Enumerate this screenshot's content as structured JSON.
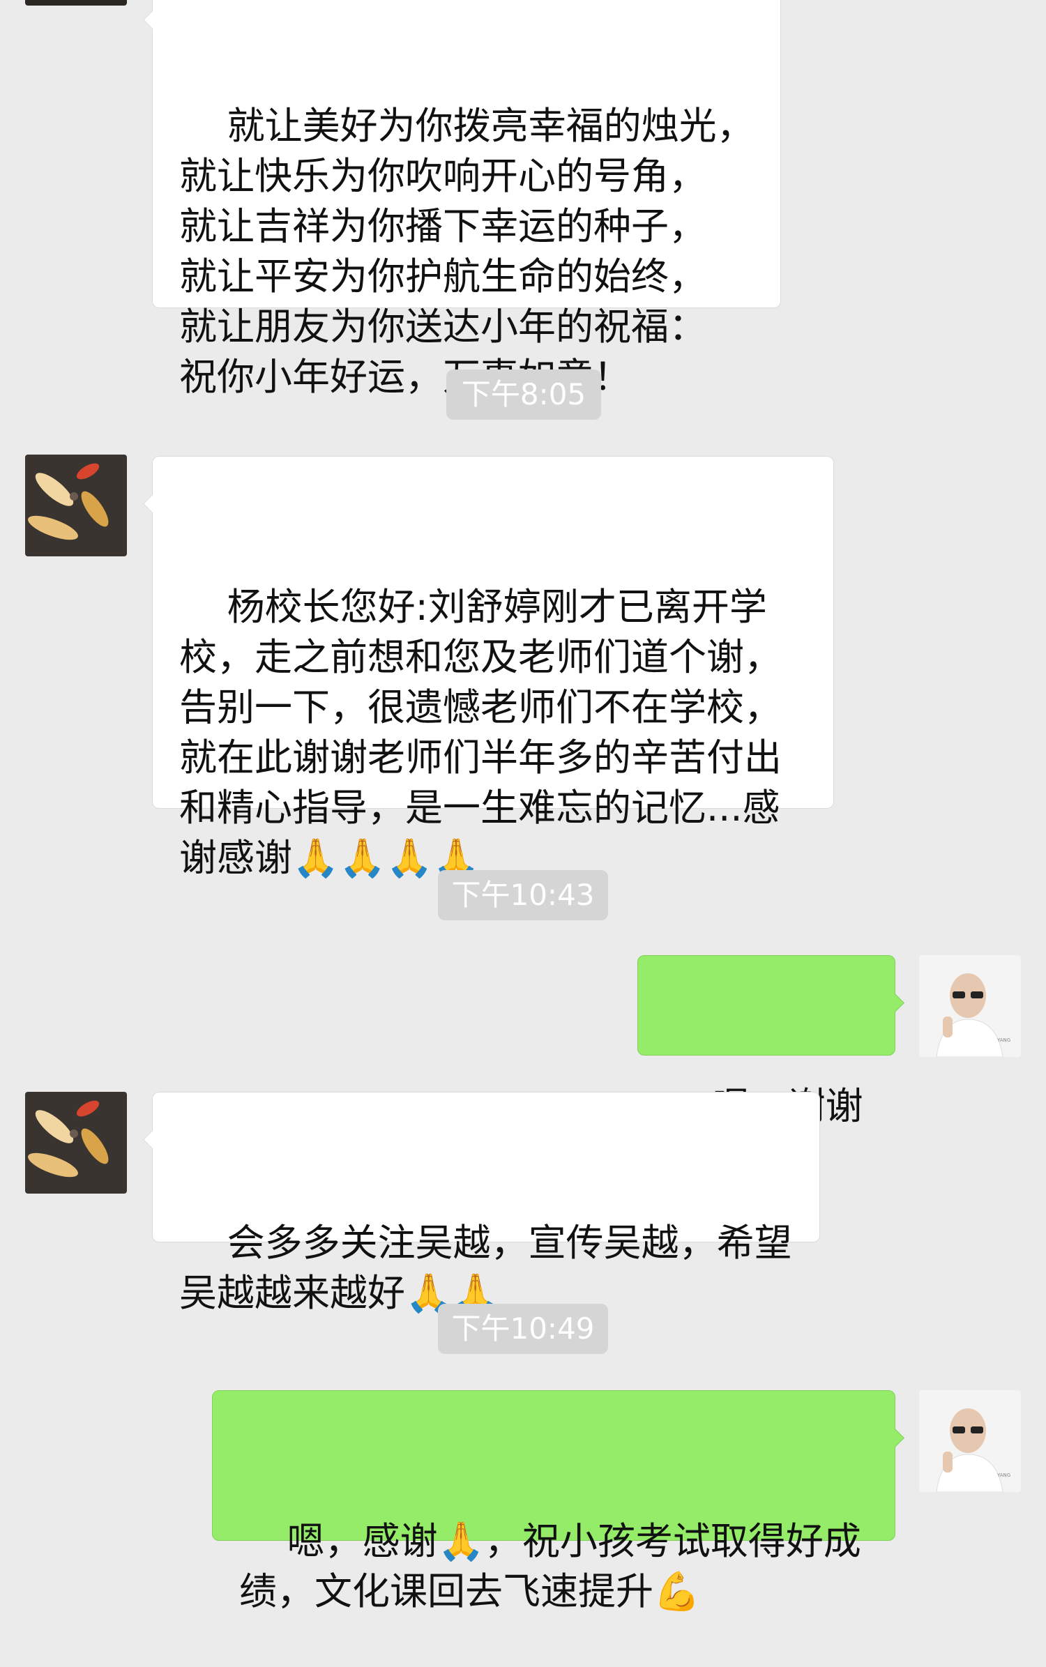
{
  "messages": {
    "m1": {
      "text": "就让美好为你拨亮幸福的烛光，\n就让快乐为你吹响开心的号角，\n就让吉祥为你播下幸运的种子，\n就让平安为你护航生命的始终，\n就让朋友为你送达小年的祝福：\n祝你小年好运，万事如意！"
    },
    "t1": "下午8:05",
    "m2": {
      "text": "杨校长您好:刘舒婷刚才已离开学校，走之前想和您及老师们道个谢，告别一下，很遗憾老师们不在学校，就在此谢谢老师们半年多的辛苦付出和精心指导，是一生难忘的记忆...感谢感谢🙏🙏🙏🙏"
    },
    "t2": "下午10:43",
    "m3": {
      "text": "嗯，谢谢您"
    },
    "m4": {
      "text": "会多多关注吴越，宣传吴越，希望吴越越来越好🙏🙏"
    },
    "t3": "下午10:49",
    "m5": {
      "text": "嗯，感谢🙏，祝小孩考试取得好成绩，文化课回去飞速提升💪"
    }
  },
  "colors": {
    "background": "#ebebeb",
    "incoming_bubble": "#ffffff",
    "outgoing_bubble": "#95ec69",
    "timestamp_bg": "#d5d5d5",
    "timestamp_text": "#ffffff"
  }
}
